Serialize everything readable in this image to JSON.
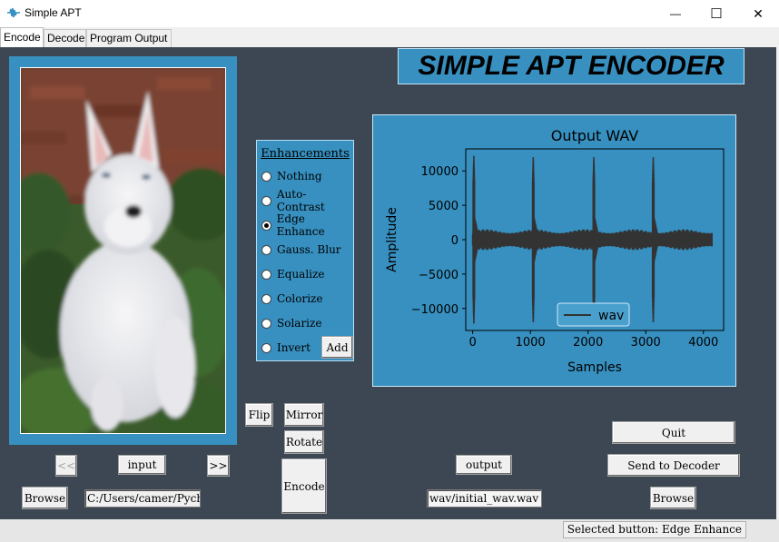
{
  "window": {
    "title": "Simple APT",
    "minimize_glyph": "—",
    "maximize_glyph": "☐",
    "close_glyph": "✕"
  },
  "tabs": [
    {
      "label": "Encode",
      "active": true
    },
    {
      "label": "Decode",
      "active": false
    },
    {
      "label": "Program Output",
      "active": false
    }
  ],
  "header": {
    "title": "SIMPLE APT ENCODER"
  },
  "enhancements": {
    "title": "Enhancements",
    "options": [
      "Nothing",
      "Auto-Contrast",
      "Edge Enhance",
      "Gauss. Blur",
      "Equalize",
      "Colorize",
      "Solarize",
      "Invert"
    ],
    "selected": "Edge Enhance",
    "add_label": "Add"
  },
  "transform": {
    "flip_label": "Flip",
    "mirror_label": "Mirror",
    "rotate_label": "Rotate",
    "encode_label": "Encode"
  },
  "input": {
    "prev_label": "<<",
    "next_label": ">>",
    "input_label": "input",
    "browse_label": "Browse",
    "path_value": "C:/Users/camer/Pychar"
  },
  "output": {
    "output_label": "output",
    "path_value": "wav/initial_wav.wav",
    "browse_label": "Browse",
    "quit_label": "Quit",
    "send_label": "Send to Decoder"
  },
  "status": {
    "text": "Selected button:  Edge Enhance"
  },
  "colors": {
    "background": "#3d4753",
    "accent": "#3790c0",
    "waveform": "#333333"
  },
  "chart_data": {
    "type": "line",
    "title": "Output WAV",
    "xlabel": "Samples",
    "ylabel": "Amplitude",
    "xlim": [
      -120,
      4350
    ],
    "ylim": [
      -13200,
      13200
    ],
    "xticks": [
      0,
      1000,
      2000,
      3000,
      4000
    ],
    "xtick_labels": [
      "0",
      "1000",
      "2000",
      "3000",
      "4000"
    ],
    "yticks": [
      10000,
      5000,
      0,
      -5000,
      -10000
    ],
    "ytick_labels": [
      "10000",
      "5000",
      "0",
      "−5000",
      "−10000"
    ],
    "legend": "bottom-center",
    "series": [
      {
        "name": "wav",
        "x_range": [
          0,
          4150
        ],
        "baseline_envelope": 1500,
        "bursts": [
          {
            "x": 20,
            "peak": 12200
          },
          {
            "x": 1050,
            "peak": 12000
          },
          {
            "x": 2100,
            "peak": 12000
          },
          {
            "x": 3130,
            "peak": 12000
          }
        ]
      }
    ]
  }
}
